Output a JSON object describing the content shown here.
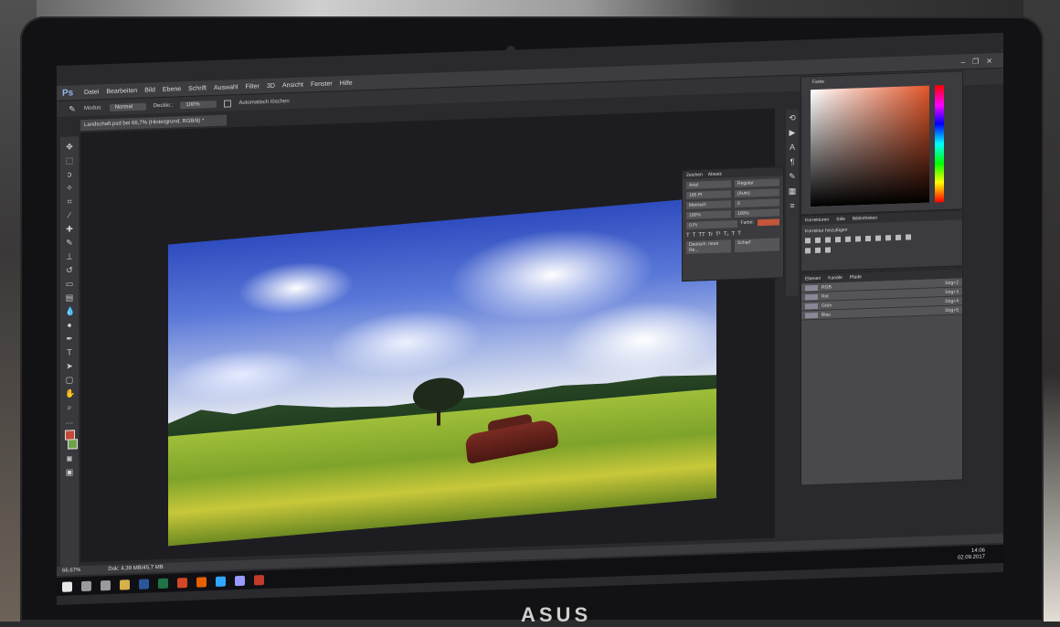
{
  "app": {
    "logo": "Ps",
    "menu": [
      "Datei",
      "Bearbeiten",
      "Bild",
      "Ebene",
      "Schrift",
      "Auswahl",
      "Filter",
      "3D",
      "Ansicht",
      "Fenster",
      "Hilfe"
    ],
    "window_controls": [
      "–",
      "❐",
      "✕"
    ]
  },
  "options_bar": {
    "mode_label": "Modus:",
    "mode_value": "Normal",
    "opacity_label": "Deckkr.:",
    "opacity_value": "100%",
    "auto_check_label": "Automatisch löschen"
  },
  "document_tab": {
    "label": "Landschaft.psd bei 66,7% (Hintergrund, RGB/8) *"
  },
  "character_panel": {
    "tabs": [
      "Zeichen",
      "Absatz"
    ],
    "font_family": "Arial",
    "font_style": "Regular",
    "font_size": "185 Pt",
    "leading": "(Auto)",
    "kerning": "Metrisch",
    "tracking": "0",
    "vertical_scale": "100%",
    "horizontal_scale": "100%",
    "baseline": "0 Pt",
    "color_label": "Farbe:",
    "language": "Deutsch: neue Re...",
    "antialias": "Scharf",
    "style_buttons": [
      "T",
      "T",
      "TT",
      "Tr",
      "T¹",
      "T₁",
      "T",
      "T"
    ]
  },
  "color_panel": {
    "title": "Farbe"
  },
  "adjustments_panel": {
    "tabs": [
      "Korrekturen",
      "Stile",
      "Bibliotheken"
    ],
    "title": "Korrektur hinzufügen"
  },
  "layers_panel": {
    "tabs": [
      "Ebenen",
      "Kanäle",
      "Pfade"
    ],
    "rows": [
      {
        "name": "RGB",
        "shortcut": "Strg+2"
      },
      {
        "name": "Rot",
        "shortcut": "Strg+3"
      },
      {
        "name": "Grün",
        "shortcut": "Strg+4"
      },
      {
        "name": "Blau",
        "shortcut": "Strg+5"
      }
    ]
  },
  "status_bar": {
    "zoom": "66,67%",
    "doc": "Dok: 4,39 MB/45,7 MB"
  },
  "taskbar": {
    "time": "14:06",
    "date": "02.09.2017",
    "icons": [
      {
        "name": "start",
        "color": "#e6e6e6"
      },
      {
        "name": "search",
        "color": "#9a9a9a"
      },
      {
        "name": "task-view",
        "color": "#9a9a9a"
      },
      {
        "name": "explorer",
        "color": "#d8b04a"
      },
      {
        "name": "word",
        "color": "#2b579a"
      },
      {
        "name": "excel",
        "color": "#217346"
      },
      {
        "name": "powerpoint",
        "color": "#d24726"
      },
      {
        "name": "firefox",
        "color": "#e66000"
      },
      {
        "name": "photoshop",
        "color": "#31a8ff"
      },
      {
        "name": "premiere",
        "color": "#9999ff"
      },
      {
        "name": "other",
        "color": "#c23b2a"
      }
    ]
  },
  "device": {
    "brand": "ASUS"
  }
}
